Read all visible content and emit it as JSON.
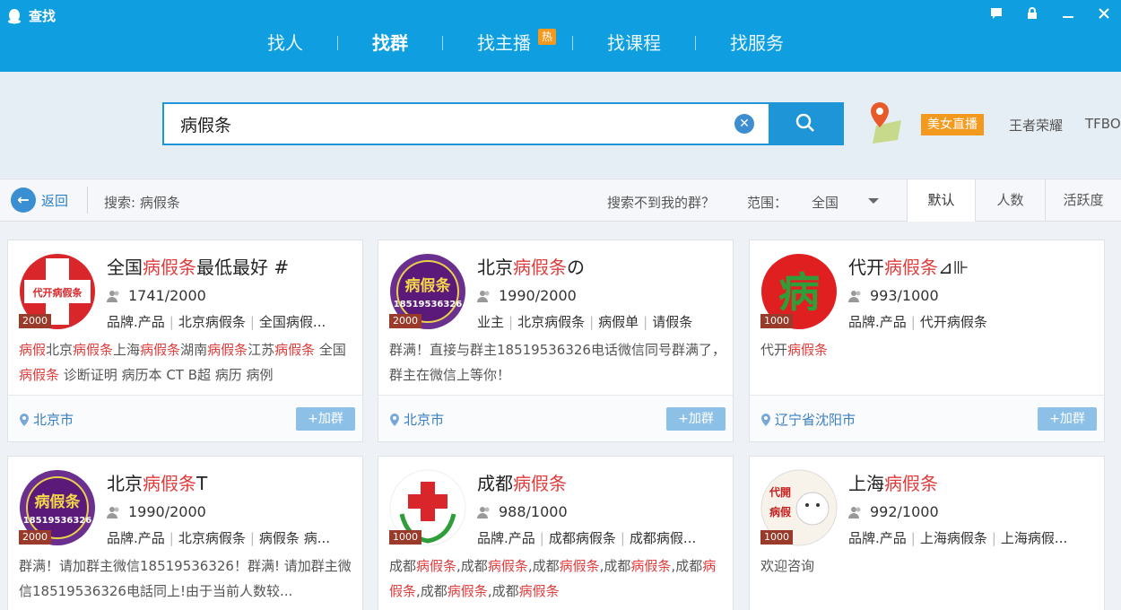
{
  "app": {
    "title": "查找"
  },
  "nav": {
    "items": [
      {
        "label": "找人"
      },
      {
        "label": "找群"
      },
      {
        "label": "找主播"
      },
      {
        "label": "找课程"
      },
      {
        "label": "找服务"
      }
    ],
    "hot_badge": "热"
  },
  "search": {
    "value": "病假条",
    "placeholder": ""
  },
  "hot_words": {
    "live": "美女直播",
    "w1": "王者荣耀",
    "w2": "TFBO"
  },
  "filter": {
    "back": "返回",
    "search_label": "搜索: 病假条",
    "cant_find": "搜索不到我的群？",
    "range_label": "范围：",
    "range_value": "全国",
    "sort": [
      "默认",
      "人数",
      "活跃度"
    ]
  },
  "results": [
    {
      "title_pre": "全国",
      "title_hl": "病假条",
      "title_post": "最低最好 #",
      "members": "1741/2000",
      "badge": "2000",
      "avatar_text": "代开病假条",
      "tags": [
        "品牌.产品",
        "北京病假条",
        "全国病假..."
      ],
      "desc": [
        [
          "病假",
          true
        ],
        [
          "北京",
          false
        ],
        [
          "病假条",
          true
        ],
        [
          "上海",
          false
        ],
        [
          "病假条",
          true
        ],
        [
          "湖南",
          false
        ],
        [
          "病假条",
          true
        ],
        [
          "江苏",
          false
        ],
        [
          "病假条",
          true
        ],
        [
          " 全国",
          false
        ],
        [
          "病假条",
          true
        ],
        [
          " 诊断证明 病历本 CT B超 病历 病例",
          false
        ]
      ],
      "location": "北京市",
      "join": "+加群"
    },
    {
      "title_pre": "北京",
      "title_hl": "病假条",
      "title_post": "の",
      "members": "1990/2000",
      "badge": "2000",
      "avatar_text": "病假条",
      "avatar_sub": "18519536326",
      "tags": [
        "业主",
        "北京病假条",
        "病假单",
        "请假条"
      ],
      "desc": [
        [
          "群满！直接与群主18519536326电话微信同号群满了，群主在微信上等你！",
          false
        ]
      ],
      "location": "北京市",
      "join": "+加群"
    },
    {
      "title_pre": "代开",
      "title_hl": "病假条",
      "title_post": "⊿⊪",
      "members": "993/1000",
      "badge": "1000",
      "avatar_text": "病",
      "tags": [
        "品牌.产品",
        "代开病假条"
      ],
      "desc": [
        [
          "代开",
          false
        ],
        [
          "病假条",
          true
        ]
      ],
      "location": "辽宁省沈阳市",
      "join": "+加群"
    },
    {
      "title_pre": "北京",
      "title_hl": "病假条",
      "title_post": "T",
      "members": "1990/2000",
      "badge": "2000",
      "avatar_text": "病假条",
      "avatar_sub": "18519536326",
      "tags": [
        "品牌.产品",
        "北京病假条",
        "病假条 病..."
      ],
      "desc": [
        [
          "群满！请加群主微信18519536326！群满! 请加群主微信18519536326电話同上!由于当前人数较...",
          false
        ]
      ],
      "location": "",
      "join": ""
    },
    {
      "title_pre": "成都",
      "title_hl": "病假条",
      "title_post": "",
      "members": "988/1000",
      "badge": "1000",
      "avatar_text": "",
      "tags": [
        "品牌.产品",
        "成都病假条",
        "成都病假..."
      ],
      "desc": [
        [
          "成都",
          false
        ],
        [
          "病假条",
          true
        ],
        [
          ",成都",
          false
        ],
        [
          "病假条",
          true
        ],
        [
          ",成都",
          false
        ],
        [
          "病假条",
          true
        ],
        [
          ",成都",
          false
        ],
        [
          "病假条",
          true
        ],
        [
          ",成都",
          false
        ],
        [
          "病假条",
          true
        ],
        [
          ",成都",
          false
        ],
        [
          "病假条",
          true
        ],
        [
          ",成都",
          false
        ],
        [
          "病假条",
          true
        ]
      ],
      "location": "",
      "join": ""
    },
    {
      "title_pre": "上海",
      "title_hl": "病假条",
      "title_post": "",
      "members": "992/1000",
      "badge": "1000",
      "avatar_text": "代開",
      "avatar_sub": "病假",
      "tags": [
        "品牌.产品",
        "上海病假条",
        "上海病假..."
      ],
      "desc": [
        [
          "欢迎咨询",
          false
        ]
      ],
      "location": "",
      "join": ""
    }
  ],
  "colors": {
    "brand": "#0f9ee0",
    "highlight": "#e03c3c",
    "hot": "#f39a1e",
    "link": "#3a7fc2"
  }
}
